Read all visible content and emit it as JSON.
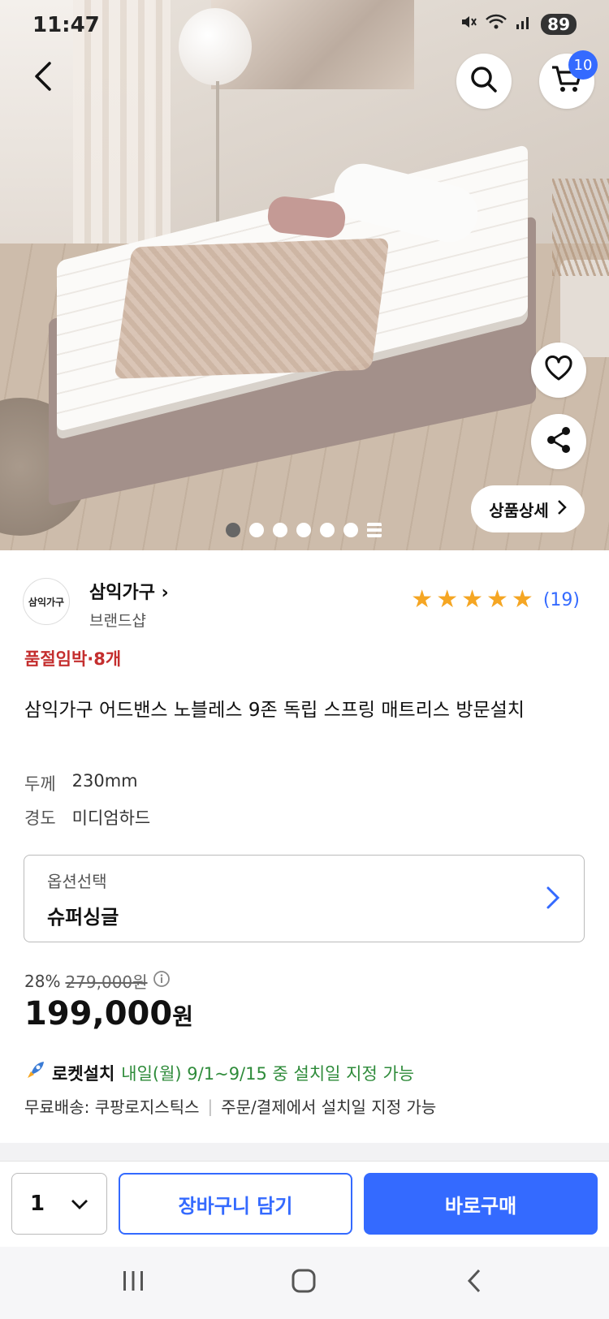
{
  "status_bar": {
    "time": "11:47",
    "battery": "89"
  },
  "header": {
    "cart_count": "10"
  },
  "hero": {
    "detail_button_label": "상품상세"
  },
  "brand": {
    "logo_text": "삼익가구",
    "name": "삼익가구",
    "sub": "브랜드샵"
  },
  "rating": {
    "stars": 5,
    "count": "(19)"
  },
  "product": {
    "stock_notice": "품절임박·8개",
    "title": "삼익가구 어드밴스 노블레스 9존 독립 스프링 매트리스 방문설치",
    "specs": [
      {
        "key": "두께",
        "value": "230mm"
      },
      {
        "key": "경도",
        "value": "미디엄하드"
      }
    ]
  },
  "option": {
    "label": "옵션선택",
    "value": "슈퍼싱글"
  },
  "price": {
    "discount": "28%",
    "original": "279,000원",
    "current": "199,000",
    "currency": "원"
  },
  "shipping": {
    "rocket_label": "로켓설치",
    "rocket_date": "내일(월) 9/1~9/15 중 설치일 지정 가능",
    "free_shipping": "무료배송: 쿠팡로지스틱스",
    "install_note": "주문/결제에서 설치일 지정 가능"
  },
  "action_bar": {
    "quantity": "1",
    "add_to_cart": "장바구니 담기",
    "buy_now": "바로구매"
  },
  "colors": {
    "accent": "#346aff",
    "star": "#f5a623",
    "stock_warning": "#c42e2e",
    "rocket_green": "#2e8b3a"
  }
}
